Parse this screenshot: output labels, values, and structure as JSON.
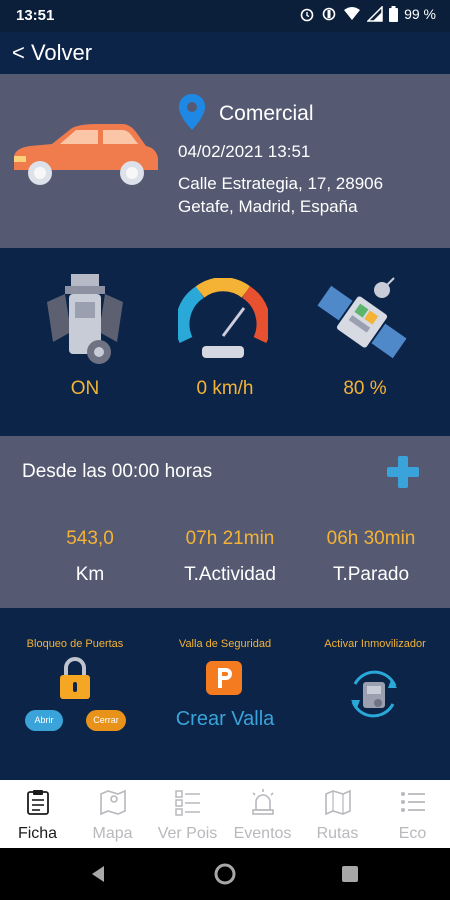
{
  "status_bar": {
    "time": "13:51",
    "battery": "99 %"
  },
  "header": {
    "back_label": "< Volver"
  },
  "vehicle": {
    "name": "Comercial",
    "datetime": "04/02/2021 13:51",
    "address_line1": "Calle Estrategia, 17, 28906",
    "address_line2": "Getafe, Madrid, España"
  },
  "status": {
    "engine": "ON",
    "speed": "0 km/h",
    "signal": "80 %"
  },
  "summary": {
    "since_label": "Desde las 00:00 horas",
    "items": [
      {
        "value": "543,0",
        "label": "Km"
      },
      {
        "value": "07h 21min",
        "label": "T.Actividad"
      },
      {
        "value": "06h 30min",
        "label": "T.Parado"
      }
    ]
  },
  "controls": {
    "door_lock_title": "Bloqueo de Puertas",
    "open_label": "Abrir",
    "close_label": "Cerrar",
    "fence_title": "Valla de Seguridad",
    "create_fence_label": "Crear Valla",
    "immobilizer_title": "Activar Inmovilizador"
  },
  "nav": {
    "items": [
      {
        "label": "Ficha",
        "icon": "document-icon"
      },
      {
        "label": "Mapa",
        "icon": "map-icon"
      },
      {
        "label": "Ver Pois",
        "icon": "poi-list-icon"
      },
      {
        "label": "Eventos",
        "icon": "alarm-light-icon"
      },
      {
        "label": "Rutas",
        "icon": "route-map-icon"
      },
      {
        "label": "Eco",
        "icon": "list-icon"
      }
    ]
  },
  "colors": {
    "navy": "#0b2448",
    "panel_gray": "#555a72",
    "accent_orange": "#f5b335",
    "link_blue": "#3aa3d9"
  }
}
